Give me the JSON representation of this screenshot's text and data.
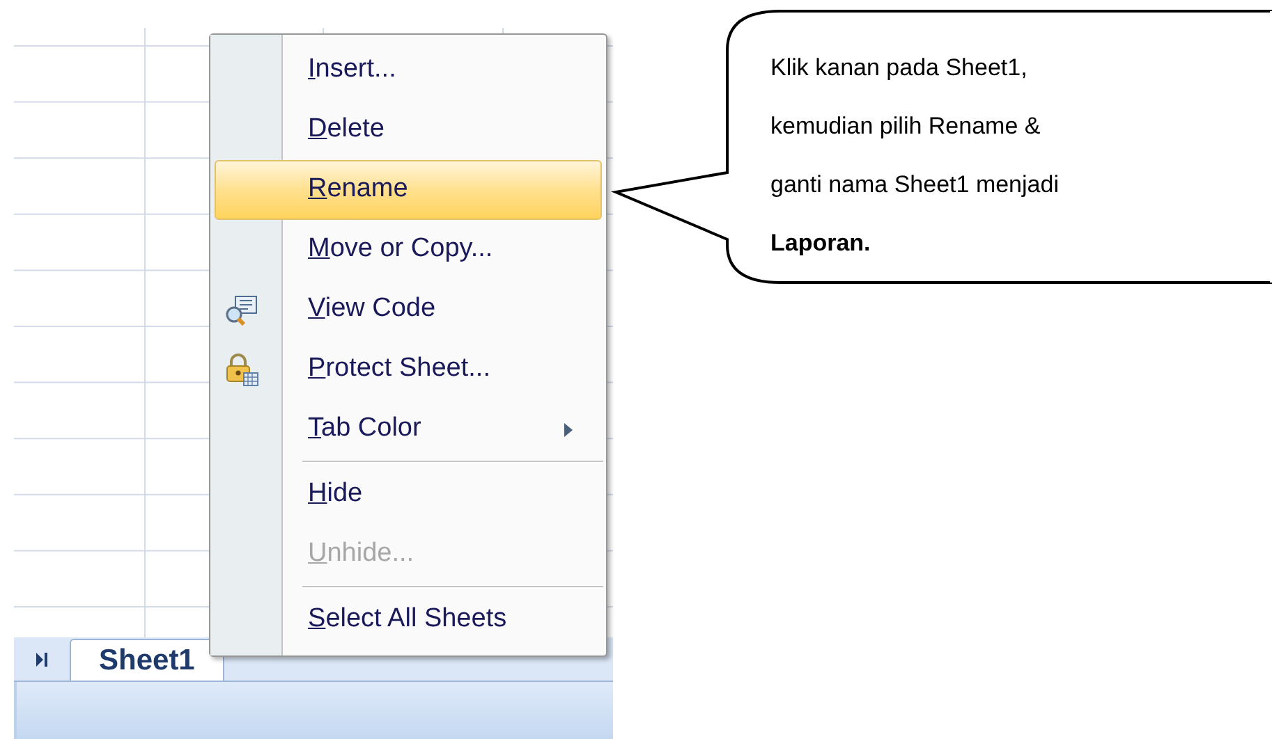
{
  "sheet_tabs": [
    {
      "label": "Sheet1",
      "selected": true
    }
  ],
  "context_menu": {
    "items": [
      {
        "kind": "item",
        "label": "Insert...",
        "submenu": false,
        "selected": false,
        "disabled": false,
        "mnemonic": true
      },
      {
        "kind": "item",
        "label": "Delete",
        "submenu": false,
        "selected": false,
        "disabled": false,
        "mnemonic": true
      },
      {
        "kind": "item",
        "label": "Rename",
        "submenu": false,
        "selected": true,
        "disabled": false,
        "mnemonic": true
      },
      {
        "kind": "item",
        "label": "Move or Copy...",
        "submenu": false,
        "selected": false,
        "disabled": false,
        "mnemonic": true
      },
      {
        "kind": "code",
        "label": "View Code",
        "submenu": false,
        "selected": false,
        "disabled": false,
        "mnemonic": true
      },
      {
        "kind": "lock",
        "label": "Protect Sheet...",
        "submenu": false,
        "selected": false,
        "disabled": false,
        "mnemonic": true
      },
      {
        "kind": "item",
        "label": "Tab Color",
        "submenu": true,
        "selected": false,
        "disabled": false,
        "mnemonic": true
      },
      {
        "kind": "separator"
      },
      {
        "kind": "item",
        "label": "Hide",
        "submenu": false,
        "selected": false,
        "disabled": false,
        "mnemonic": true
      },
      {
        "kind": "item",
        "label": "Unhide...",
        "submenu": false,
        "selected": false,
        "disabled": true,
        "mnemonic": true
      },
      {
        "kind": "separator"
      },
      {
        "kind": "item",
        "label": "Select All Sheets",
        "submenu": false,
        "selected": false,
        "disabled": false,
        "mnemonic": true
      }
    ]
  },
  "callout": {
    "text": "Klik kanan pada Sheet1,\nkemudian pilih  Rename &\nganti nama Sheet1 menjadi\n**Laporan.**"
  }
}
